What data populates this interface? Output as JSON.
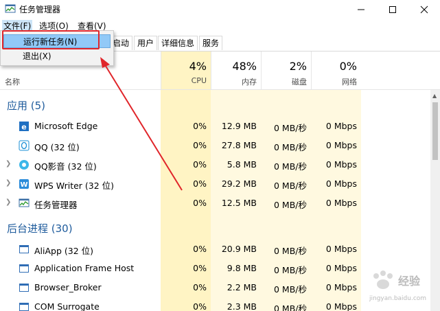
{
  "window": {
    "title": "任务管理器",
    "icon": "task-manager-icon",
    "controls": [
      "minimize-icon",
      "maximize-icon",
      "close-icon"
    ]
  },
  "menu": [
    "文件(F)",
    "选项(O)",
    "查看(V)"
  ],
  "dropdown": {
    "items": [
      "运行新任务(N)",
      "退出(X)"
    ],
    "selected_index": 0
  },
  "tabs": [
    "启动",
    "用户",
    "详细信息",
    "服务"
  ],
  "columns": {
    "name_label": "名称",
    "cpu": {
      "pct": "4%",
      "label": "CPU"
    },
    "mem": {
      "pct": "48%",
      "label": "内存"
    },
    "disk": {
      "pct": "2%",
      "label": "磁盘"
    },
    "net": {
      "pct": "0%",
      "label": "网络"
    }
  },
  "groups": [
    {
      "title": "应用 (5)",
      "rows": [
        {
          "icon": "edge-icon",
          "name": "Microsoft Edge",
          "expandable": false,
          "cpu": "0%",
          "mem": "12.9 MB",
          "disk": "0 MB/秒",
          "net": "0 Mbps"
        },
        {
          "icon": "qq-icon",
          "name": "QQ (32 位)",
          "expandable": false,
          "cpu": "0%",
          "mem": "27.8 MB",
          "disk": "0 MB/秒",
          "net": "0 Mbps"
        },
        {
          "icon": "qqplayer-icon",
          "name": "QQ影音 (32 位)",
          "expandable": true,
          "cpu": "0%",
          "mem": "5.8 MB",
          "disk": "0 MB/秒",
          "net": "0 Mbps"
        },
        {
          "icon": "wps-writer-icon",
          "name": "WPS Writer (32 位)",
          "expandable": true,
          "cpu": "0%",
          "mem": "29.2 MB",
          "disk": "0 MB/秒",
          "net": "0 Mbps"
        },
        {
          "icon": "task-manager-icon",
          "name": "任务管理器",
          "expandable": true,
          "cpu": "0%",
          "mem": "12.5 MB",
          "disk": "0 MB/秒",
          "net": "0 Mbps"
        }
      ]
    },
    {
      "title": "后台进程 (30)",
      "rows": [
        {
          "icon": "app-window-icon",
          "name": "AliApp (32 位)",
          "expandable": false,
          "cpu": "0%",
          "mem": "20.9 MB",
          "disk": "0 MB/秒",
          "net": "0 Mbps"
        },
        {
          "icon": "app-window-icon",
          "name": "Application Frame Host",
          "expandable": false,
          "cpu": "0%",
          "mem": "9.8 MB",
          "disk": "0 MB/秒",
          "net": "0 Mbps"
        },
        {
          "icon": "app-window-icon",
          "name": "Browser_Broker",
          "expandable": false,
          "cpu": "0%",
          "mem": "2.2 MB",
          "disk": "0 MB/秒",
          "net": "0 Mbps"
        },
        {
          "icon": "app-window-icon",
          "name": "COM Surrogate",
          "expandable": false,
          "cpu": "0%",
          "mem": "2.3 MB",
          "disk": "0 MB/秒",
          "net": "0 Mbps"
        }
      ]
    }
  ],
  "colors": {
    "highlight_column": "#fff4c4",
    "group_title": "#1e5b9c",
    "annotation": "#e0252a",
    "menu_selected": "#91c9f7"
  },
  "watermark": {
    "logo": "baidu-paw-icon",
    "text": "经验",
    "subtext": "jingyan.baidu.com"
  }
}
